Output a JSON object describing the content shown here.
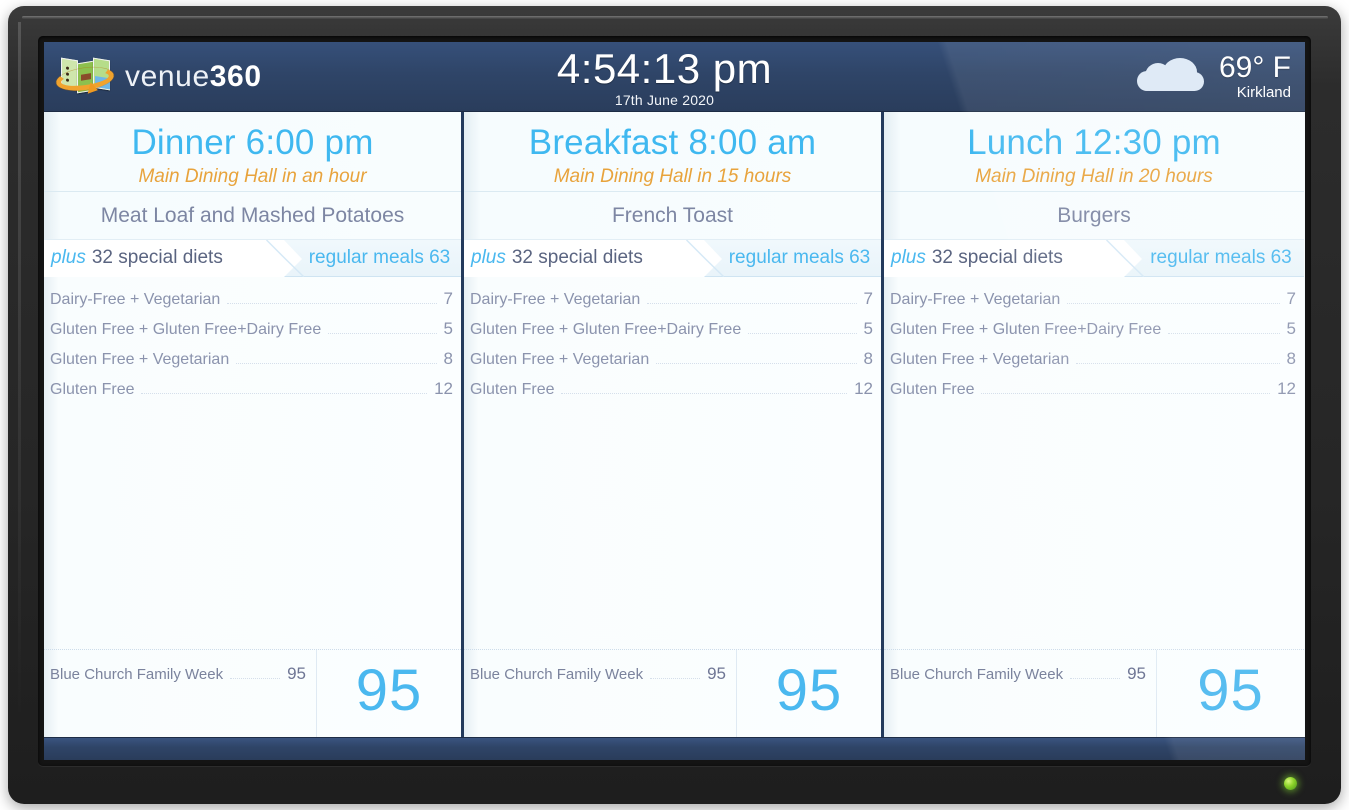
{
  "header": {
    "brand_name_light": "venue",
    "brand_name_bold": "360",
    "logo_icon": "map-360-logo-icon",
    "clock": {
      "time": "4:54:13 pm",
      "date": "17th June 2020"
    },
    "weather": {
      "icon": "cloud-icon",
      "temperature": "69° F",
      "location": "Kirkland"
    }
  },
  "panels": [
    {
      "meal_title": "Dinner 6:00 pm",
      "location_and_eta": "Main Dining Hall in an hour",
      "menu_name": "Meat Loaf and Mashed Potatoes",
      "tab_active_prefix": "plus",
      "tab_active_label": "32 special diets",
      "tab_inactive_label": "regular meals 63",
      "diets": [
        {
          "label": "Dairy-Free + Vegetarian",
          "count": "7"
        },
        {
          "label": "Gluten Free + Gluten Free+Dairy Free",
          "count": "5"
        },
        {
          "label": "Gluten Free + Vegetarian",
          "count": "8"
        },
        {
          "label": "Gluten Free",
          "count": "12"
        }
      ],
      "footer_group_label": "Blue Church Family Week",
      "footer_group_count": "95",
      "footer_total": "95"
    },
    {
      "meal_title": "Breakfast 8:00 am",
      "location_and_eta": "Main Dining Hall in 15 hours",
      "menu_name": "French Toast",
      "tab_active_prefix": "plus",
      "tab_active_label": "32 special diets",
      "tab_inactive_label": "regular meals 63",
      "diets": [
        {
          "label": "Dairy-Free + Vegetarian",
          "count": "7"
        },
        {
          "label": "Gluten Free + Gluten Free+Dairy Free",
          "count": "5"
        },
        {
          "label": "Gluten Free + Vegetarian",
          "count": "8"
        },
        {
          "label": "Gluten Free",
          "count": "12"
        }
      ],
      "footer_group_label": "Blue Church Family Week",
      "footer_group_count": "95",
      "footer_total": "95"
    },
    {
      "meal_title": "Lunch 12:30 pm",
      "location_and_eta": "Main Dining Hall in 20 hours",
      "menu_name": "Burgers",
      "tab_active_prefix": "plus",
      "tab_active_label": "32 special diets",
      "tab_inactive_label": "regular meals 63",
      "diets": [
        {
          "label": "Dairy-Free + Vegetarian",
          "count": "7"
        },
        {
          "label": "Gluten Free + Gluten Free+Dairy Free",
          "count": "5"
        },
        {
          "label": "Gluten Free + Vegetarian",
          "count": "8"
        },
        {
          "label": "Gluten Free",
          "count": "12"
        }
      ],
      "footer_group_label": "Blue Church Family Week",
      "footer_group_count": "95",
      "footer_total": "95"
    }
  ],
  "colors": {
    "header_blue": "#2f4568",
    "accent_cyan": "#4ab8ef",
    "accent_orange": "#e8a33c",
    "panel_divider": "#233a5c",
    "muted_text": "#8b93ad",
    "led_green": "#8dd42a"
  },
  "device": {
    "power_led": "power-led-indicator"
  }
}
